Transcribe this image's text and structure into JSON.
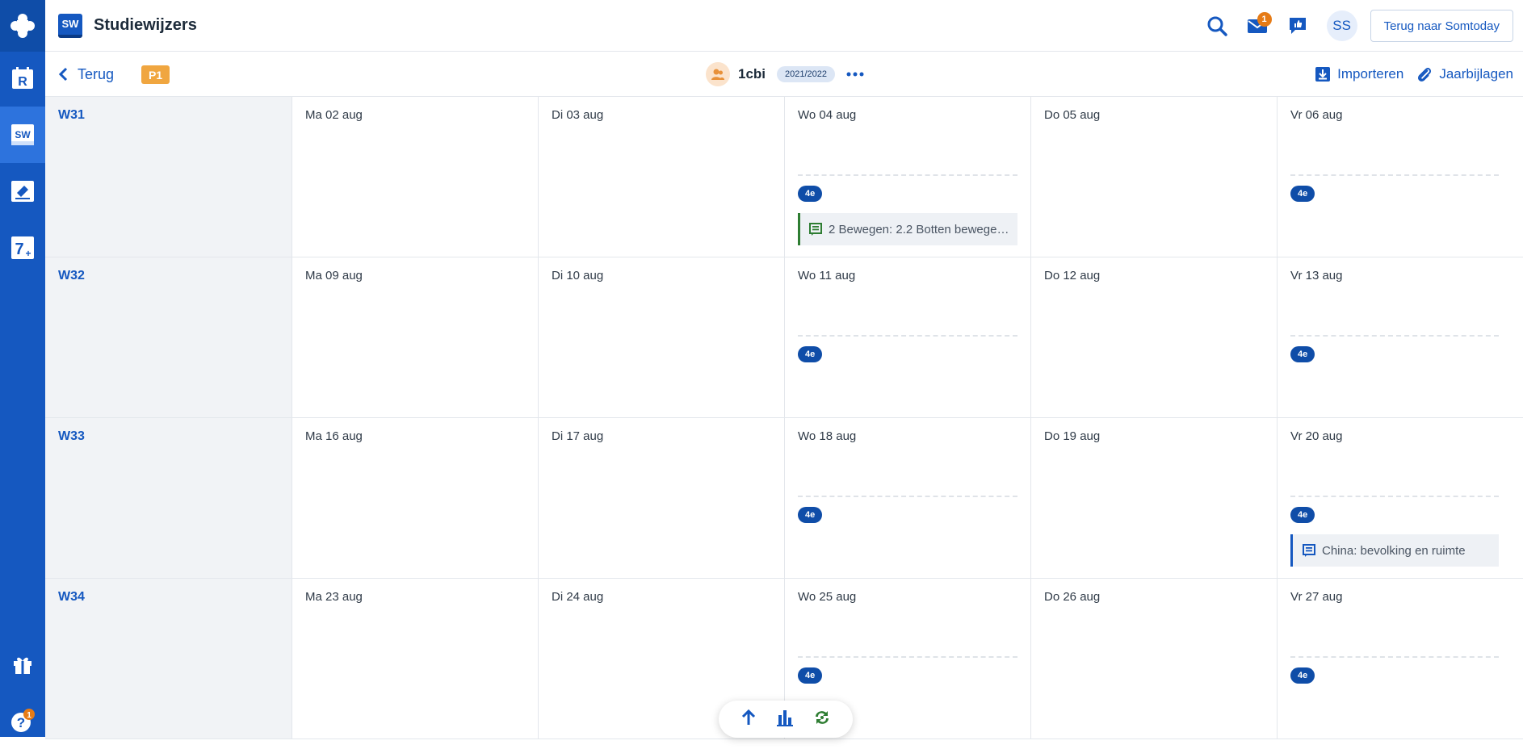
{
  "app": {
    "badge": "SW",
    "title": "Studiewijzers"
  },
  "rail": {
    "items": [
      {
        "name": "somtoday-logo-icon"
      },
      {
        "name": "rooster-icon",
        "letter": "R"
      },
      {
        "name": "studiewijzer-icon",
        "letter": "SW",
        "active": true
      },
      {
        "name": "inleveren-icon"
      },
      {
        "name": "cijfers-icon",
        "letter": "7+"
      }
    ],
    "bottom": [
      {
        "name": "gift-icon"
      },
      {
        "name": "help-icon",
        "badge": "1"
      }
    ]
  },
  "header": {
    "messages_badge": "1",
    "avatar_initials": "SS",
    "back_to_somtoday": "Terug naar Somtoday"
  },
  "subbar": {
    "back_label": "Terug",
    "period": "P1",
    "group_name": "1cbi",
    "school_year": "2021/2022",
    "import_label": "Importeren",
    "attachments_label": "Jaarbijlagen"
  },
  "weeks": [
    {
      "label": "W31",
      "days": [
        {
          "label": "Ma 02 aug"
        },
        {
          "label": "Di 03 aug"
        },
        {
          "label": "Wo 04 aug",
          "hour": "4e",
          "task": "2 Bewegen: 2.2 Botten bewegen:...",
          "task_color": "#2e7d32"
        },
        {
          "label": "Do 05 aug"
        },
        {
          "label": "Vr 06 aug",
          "hour": "4e"
        }
      ]
    },
    {
      "label": "W32",
      "days": [
        {
          "label": "Ma 09 aug"
        },
        {
          "label": "Di 10 aug"
        },
        {
          "label": "Wo 11 aug",
          "hour": "4e"
        },
        {
          "label": "Do 12 aug"
        },
        {
          "label": "Vr 13 aug",
          "hour": "4e"
        }
      ]
    },
    {
      "label": "W33",
      "days": [
        {
          "label": "Ma 16 aug"
        },
        {
          "label": "Di 17 aug"
        },
        {
          "label": "Wo 18 aug",
          "hour": "4e"
        },
        {
          "label": "Do 19 aug"
        },
        {
          "label": "Vr 20 aug",
          "hour": "4e",
          "task": "China: bevolking en ruimte",
          "task_color": "#1558c0"
        }
      ]
    },
    {
      "label": "W34",
      "days": [
        {
          "label": "Ma 23 aug"
        },
        {
          "label": "Di 24 aug"
        },
        {
          "label": "Wo 25 aug",
          "hour": "4e"
        },
        {
          "label": "Do 26 aug"
        },
        {
          "label": "Vr 27 aug",
          "hour": "4e"
        }
      ]
    }
  ],
  "floating": {
    "buttons": [
      "scroll-up-icon",
      "chart-icon",
      "sync-icon"
    ]
  }
}
